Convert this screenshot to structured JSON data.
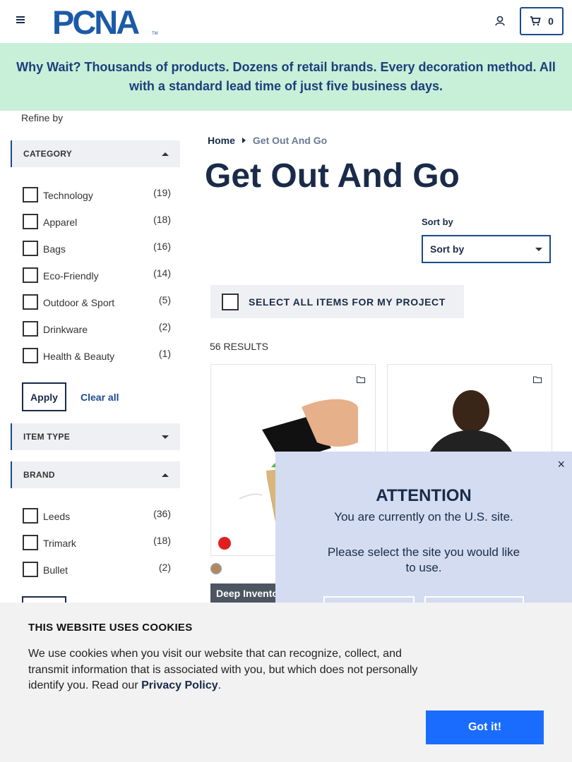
{
  "header": {
    "logo_text": "PCNA",
    "logo_tm": "TM",
    "cart_count": "0",
    "brand_color": "#1c5aa8"
  },
  "banner": {
    "text": "Why Wait? Thousands of products. Dozens of retail brands. Every decoration method. All with a standard lead time of just five business days.",
    "background": "#c8efd8"
  },
  "sidebar": {
    "refine_label": "Refine by",
    "category": {
      "title": "CATEGORY",
      "items": [
        {
          "label": "Technology",
          "count": "(19)"
        },
        {
          "label": "Apparel",
          "count": "(18)"
        },
        {
          "label": "Bags",
          "count": "(16)"
        },
        {
          "label": "Eco-Friendly",
          "count": "(14)"
        },
        {
          "label": "Outdoor & Sport",
          "count": "(5)"
        },
        {
          "label": "Drinkware",
          "count": "(2)"
        },
        {
          "label": "Health & Beauty",
          "count": "(1)"
        }
      ],
      "apply_label": "Apply",
      "clear_label": "Clear all"
    },
    "item_type": {
      "title": "ITEM TYPE"
    },
    "brand": {
      "title": "BRAND",
      "items": [
        {
          "label": "Leeds",
          "count": "(36)"
        },
        {
          "label": "Trimark",
          "count": "(18)"
        },
        {
          "label": "Bullet",
          "count": "(2)"
        }
      ]
    }
  },
  "main": {
    "breadcrumb": {
      "home": "Home",
      "current": "Get Out And Go"
    },
    "title": "Get Out And Go",
    "sort": {
      "label": "Sort by",
      "value": "Sort by"
    },
    "select_all_label": "SELECT ALL ITEMS FOR MY PROJECT",
    "results": "56 RESULTS",
    "product1": {
      "badge": "Deep Inventory"
    }
  },
  "attention_modal": {
    "title": "ATTENTION",
    "line1": "You are currently on the U.S. site.",
    "line2": "Please select the site you would like to use.",
    "close": "×"
  },
  "cookie_banner": {
    "title": "THIS WEBSITE USES COOKIES",
    "body": "We use cookies when you visit our website that can recognize, collect, and transmit information that is associated with you, but which does not personally identify you. Read our",
    "link": "Privacy Policy",
    "end": ".",
    "button": "Got it!",
    "button_color": "#1a6cff"
  }
}
